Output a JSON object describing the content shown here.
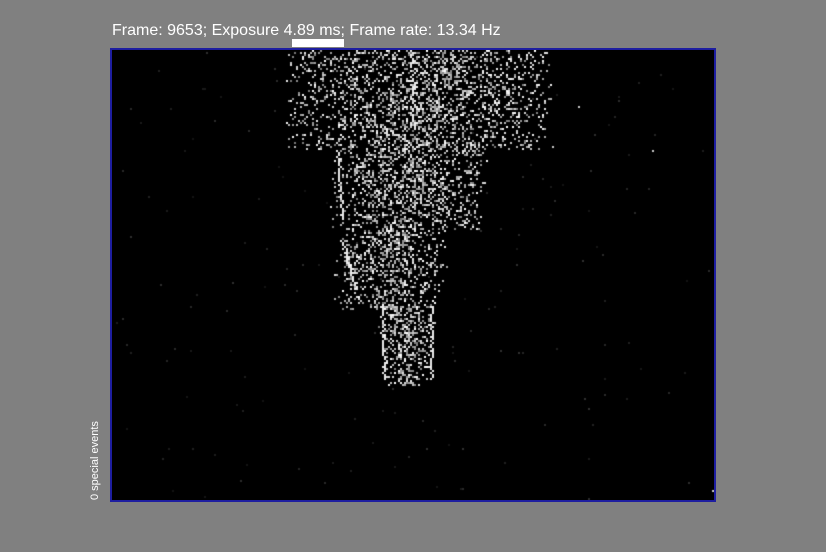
{
  "header": {
    "frame_info": "Frame: 9653; Exposure 4.89 ms; Frame rate: 13.34 Hz"
  },
  "side": {
    "special_events_label": "0 special events"
  },
  "colors": {
    "background": "#808080",
    "view_background": "#000000",
    "view_border": "#1e1ea0",
    "event_pixel": "#ffffff"
  }
}
